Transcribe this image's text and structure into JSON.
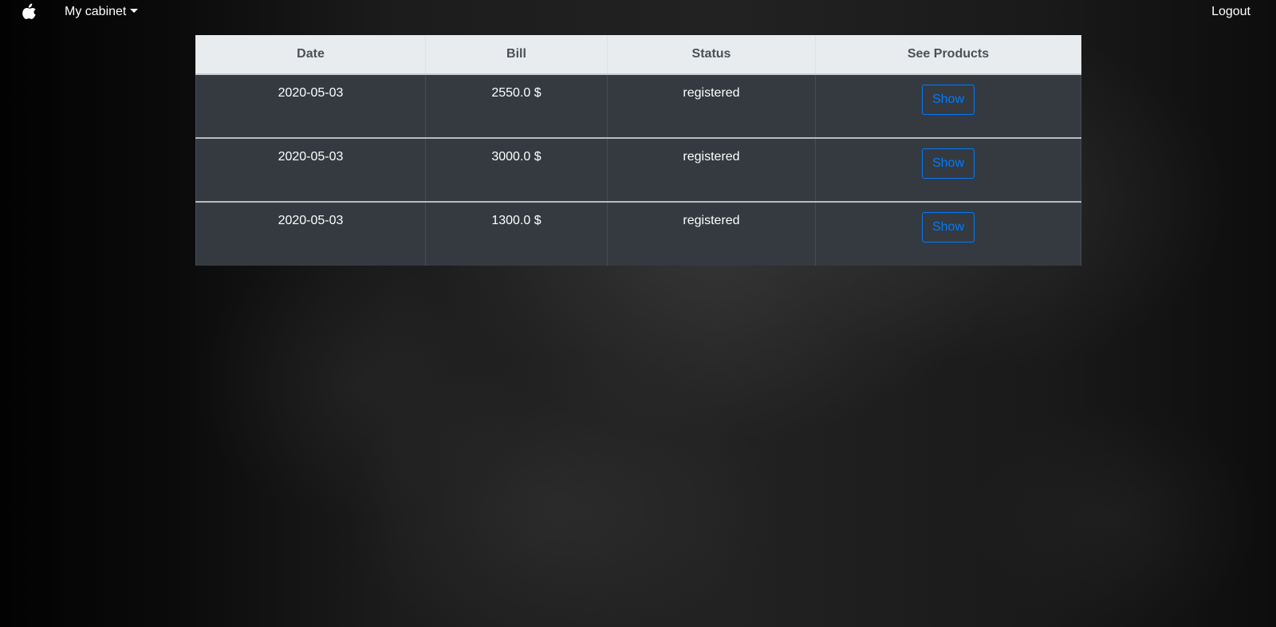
{
  "navbar": {
    "brand_icon": "apple-logo-icon",
    "cabinet_label": "My cabinet",
    "logout_label": "Logout"
  },
  "orders_table": {
    "headers": [
      "Date",
      "Bill",
      "Status",
      "See Products"
    ],
    "rows": [
      {
        "date": "2020-05-03",
        "bill": "2550.0 $",
        "status": "registered",
        "action_label": "Show"
      },
      {
        "date": "2020-05-03",
        "bill": "3000.0 $",
        "status": "registered",
        "action_label": "Show"
      },
      {
        "date": "2020-05-03",
        "bill": "1300.0 $",
        "status": "registered",
        "action_label": "Show"
      }
    ]
  },
  "colors": {
    "header_bg": "#e9ecef",
    "row_bg": "#343a40",
    "button_accent": "#007bff"
  }
}
